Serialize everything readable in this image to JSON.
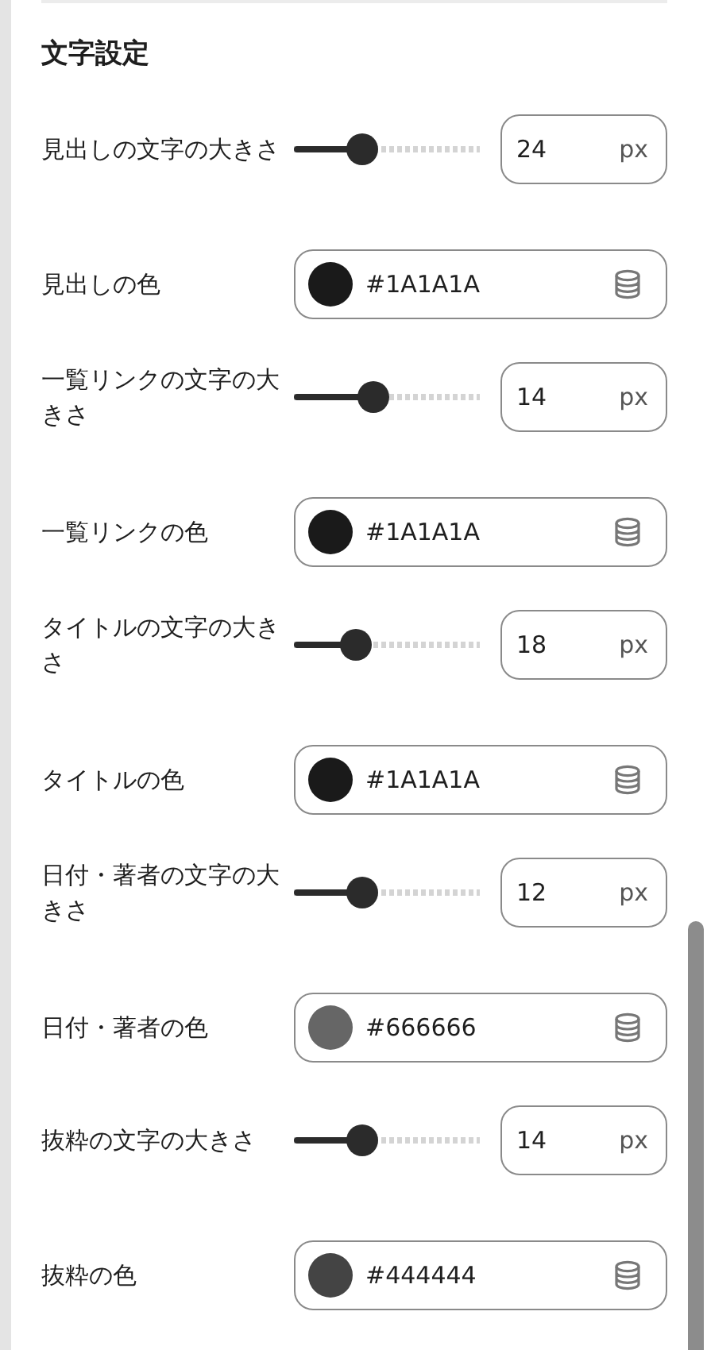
{
  "section": {
    "title": "文字設定"
  },
  "rows": [
    {
      "kind": "slider",
      "label": "見出しの文字の大きさ",
      "level": 0.37,
      "value": "24",
      "unit": "px"
    },
    {
      "kind": "color",
      "label": "見出しの色",
      "color": "#1a1a1a",
      "value": "#1A1A1A"
    },
    {
      "kind": "slider",
      "label": "一覧リンクの文字の大きさ",
      "level": 0.43,
      "value": "14",
      "unit": "px"
    },
    {
      "kind": "color",
      "label": "一覧リンクの色",
      "color": "#1a1a1a",
      "value": "#1A1A1A"
    },
    {
      "kind": "slider",
      "label": "タイトルの文字の大きさ",
      "level": 0.33,
      "value": "18",
      "unit": "px"
    },
    {
      "kind": "color",
      "label": "タイトルの色",
      "color": "#1a1a1a",
      "value": "#1A1A1A"
    },
    {
      "kind": "slider",
      "label": "日付・著者の文字の大きさ",
      "level": 0.37,
      "value": "12",
      "unit": "px"
    },
    {
      "kind": "color",
      "label": "日付・著者の色",
      "color": "#666666",
      "value": "#666666"
    },
    {
      "kind": "slider",
      "label": "抜粋の文字の大きさ",
      "level": 0.37,
      "value": "14",
      "unit": "px"
    },
    {
      "kind": "color",
      "label": "抜粋の色",
      "color": "#444444",
      "value": "#444444"
    }
  ]
}
